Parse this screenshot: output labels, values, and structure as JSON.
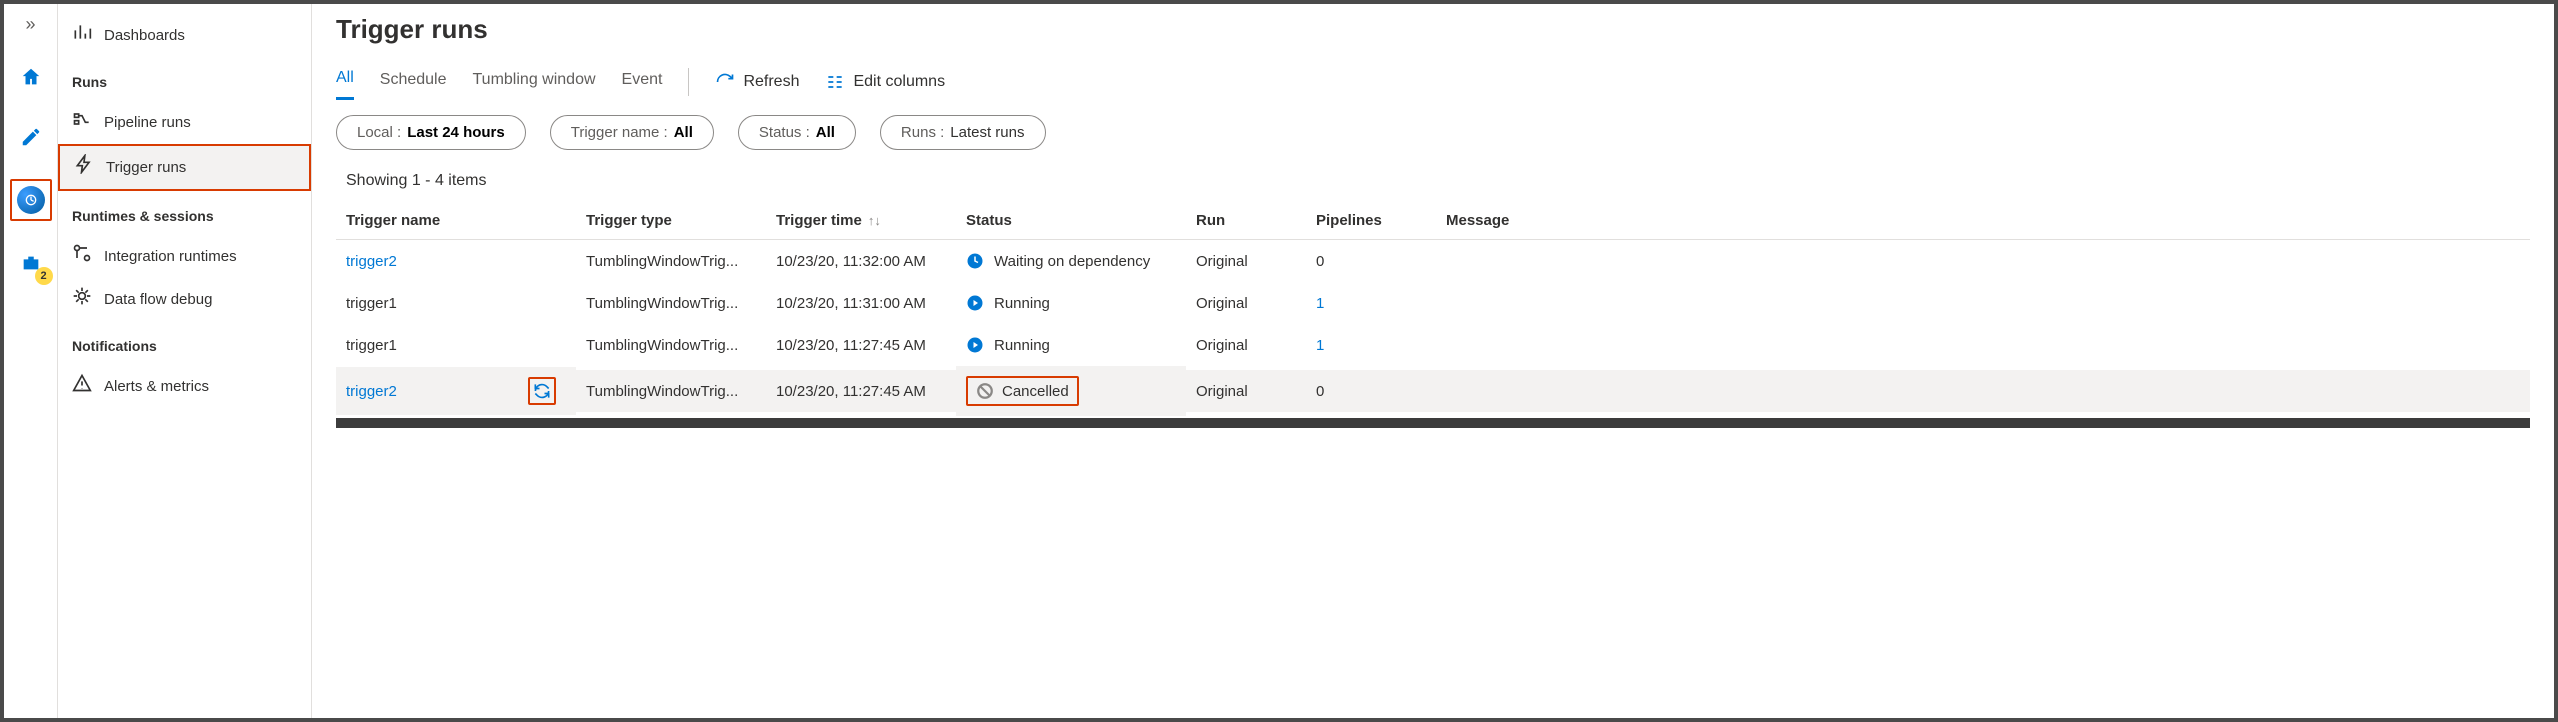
{
  "rail": {
    "toolbox_badge": "2"
  },
  "sidebar": {
    "dashboards": "Dashboards",
    "runs_heading": "Runs",
    "pipeline_runs": "Pipeline runs",
    "trigger_runs": "Trigger runs",
    "runtimes_heading": "Runtimes & sessions",
    "integration_runtimes": "Integration runtimes",
    "data_flow_debug": "Data flow debug",
    "notifications_heading": "Notifications",
    "alerts_metrics": "Alerts & metrics"
  },
  "header": {
    "title": "Trigger runs"
  },
  "tabs": {
    "all": "All",
    "schedule": "Schedule",
    "tumbling": "Tumbling window",
    "event": "Event",
    "refresh": "Refresh",
    "edit_columns": "Edit columns"
  },
  "filters": {
    "local_k": "Local :",
    "local_v": "Last 24 hours",
    "trigger_k": "Trigger name :",
    "trigger_v": "All",
    "status_k": "Status :",
    "status_v": "All",
    "runs_k": "Runs :",
    "runs_v": "Latest runs"
  },
  "showing": "Showing 1 - 4 items",
  "columns": {
    "trigger_name": "Trigger name",
    "trigger_type": "Trigger type",
    "trigger_time": "Trigger time",
    "status": "Status",
    "run": "Run",
    "pipelines": "Pipelines",
    "message": "Message"
  },
  "rows": [
    {
      "name": "trigger2",
      "name_link": true,
      "type": "TumblingWindowTrig...",
      "time": "10/23/20, 11:32:00 AM",
      "status": "Waiting on dependency",
      "status_kind": "waiting",
      "run": "Original",
      "pipelines": "0",
      "pipelines_link": false
    },
    {
      "name": "trigger1",
      "name_link": false,
      "type": "TumblingWindowTrig...",
      "time": "10/23/20, 11:31:00 AM",
      "status": "Running",
      "status_kind": "running",
      "run": "Original",
      "pipelines": "1",
      "pipelines_link": true
    },
    {
      "name": "trigger1",
      "name_link": false,
      "type": "TumblingWindowTrig...",
      "time": "10/23/20, 11:27:45 AM",
      "status": "Running",
      "status_kind": "running",
      "run": "Original",
      "pipelines": "1",
      "pipelines_link": true
    },
    {
      "name": "trigger2",
      "name_link": true,
      "type": "TumblingWindowTrig...",
      "time": "10/23/20, 11:27:45 AM",
      "status": "Cancelled",
      "status_kind": "cancelled",
      "run": "Original",
      "pipelines": "0",
      "pipelines_link": false,
      "hovered": true
    }
  ]
}
